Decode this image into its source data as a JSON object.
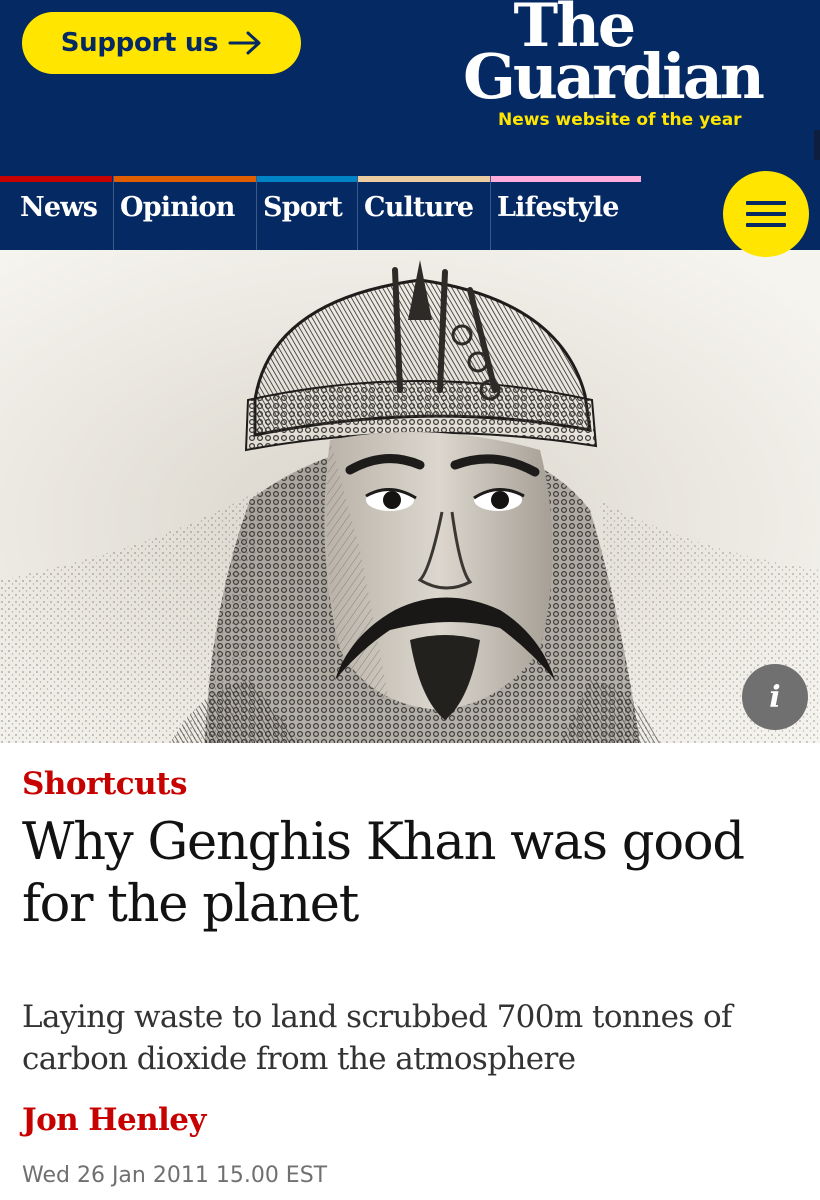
{
  "header": {
    "support_label": "Support us",
    "logo_the": "The",
    "logo_guardian": "Guardian",
    "tagline": "News website of the year",
    "menu_icon": "hamburger-menu-icon",
    "colors": {
      "brand_blue": "#052962",
      "yellow": "#ffe500"
    }
  },
  "nav": {
    "items": [
      {
        "label": "News",
        "color": "#c70000"
      },
      {
        "label": "Opinion",
        "color": "#e05e00"
      },
      {
        "label": "Sport",
        "color": "#0084c6"
      },
      {
        "label": "Culture",
        "color": "#eacca0"
      },
      {
        "label": "Lifestyle",
        "color": "#ffabdb"
      }
    ]
  },
  "hero": {
    "info_icon_label": "i"
  },
  "article": {
    "kicker": "Shortcuts",
    "headline": "Why Genghis Khan was good for the planet",
    "standfirst": "Laying waste to land scrubbed 700m tonnes of carbon dioxide from the atmosphere",
    "byline": "Jon Henley",
    "dateline": "Wed 26 Jan 2011 15.00 EST",
    "accent_color": "#c70000"
  }
}
